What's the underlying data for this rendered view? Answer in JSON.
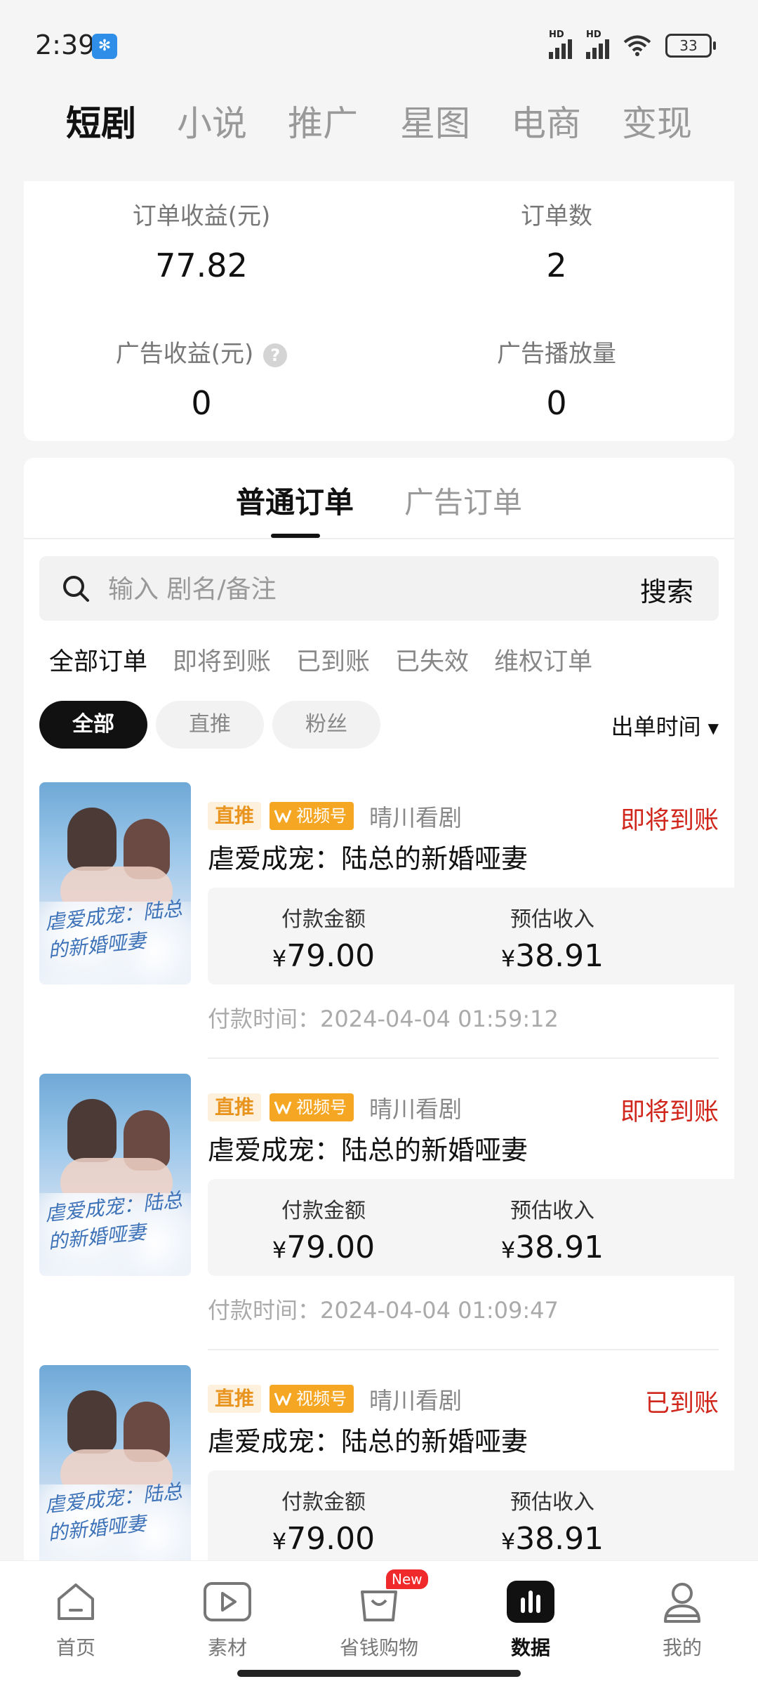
{
  "status_bar": {
    "time": "2:39",
    "battery": "33",
    "signal_label": "HD"
  },
  "top_tabs": [
    {
      "label": "短剧",
      "active": true
    },
    {
      "label": "小说",
      "active": false
    },
    {
      "label": "推广",
      "active": false
    },
    {
      "label": "星图",
      "active": false
    },
    {
      "label": "电商",
      "active": false
    },
    {
      "label": "变现",
      "active": false
    }
  ],
  "stats": {
    "order_income_label": "订单收益(元)",
    "order_income_value": "77.82",
    "order_count_label": "订单数",
    "order_count_value": "2",
    "ad_income_label": "广告收益(元)",
    "ad_income_value": "0",
    "ad_plays_label": "广告播放量",
    "ad_plays_value": "0"
  },
  "order_tabs": {
    "normal": "普通订单",
    "ad": "广告订单"
  },
  "search": {
    "placeholder": "输入 剧名/备注",
    "button": "搜索"
  },
  "filters": [
    "全部订单",
    "即将到账",
    "已到账",
    "已失效",
    "维权订单"
  ],
  "chips": [
    "全部",
    "直推",
    "粉丝"
  ],
  "sort_label": "出单时间",
  "orders": [
    {
      "tag": "直推",
      "channel_tag": "视频号",
      "channel_name": "晴川看剧",
      "status": "即将到账",
      "title": "虐爱成宠：陆总的新婚哑妻",
      "pay_label": "付款金额",
      "pay_value": "79.00",
      "income_label": "预估收入",
      "income_value": "38.91",
      "pay_time": "付款时间：2024-04-04 01:59:12",
      "poster_title": "虐爱成宠：陆总的新婚哑妻"
    },
    {
      "tag": "直推",
      "channel_tag": "视频号",
      "channel_name": "晴川看剧",
      "status": "即将到账",
      "title": "虐爱成宠：陆总的新婚哑妻",
      "pay_label": "付款金额",
      "pay_value": "79.00",
      "income_label": "预估收入",
      "income_value": "38.91",
      "pay_time": "付款时间：2024-04-04 01:09:47",
      "poster_title": "虐爱成宠：陆总的新婚哑妻"
    },
    {
      "tag": "直推",
      "channel_tag": "视频号",
      "channel_name": "晴川看剧",
      "status": "已到账",
      "title": "虐爱成宠：陆总的新婚哑妻",
      "pay_label": "付款金额",
      "pay_value": "79.00",
      "income_label": "预估收入",
      "income_value": "38.91",
      "pay_time": "",
      "poster_title": "虐爱成宠：陆总的新婚哑妻"
    }
  ],
  "currency_symbol": "¥",
  "bottom_nav": [
    {
      "label": "首页",
      "icon": "home-icon"
    },
    {
      "label": "素材",
      "icon": "play-icon"
    },
    {
      "label": "省钱购物",
      "icon": "shopping-bag-icon",
      "badge": "New"
    },
    {
      "label": "数据",
      "icon": "bar-chart-icon",
      "active": true
    },
    {
      "label": "我的",
      "icon": "person-icon"
    }
  ],
  "colors": {
    "accent_red": "#d0261c",
    "tag_orange": "#f5a623",
    "active_dark": "#111111"
  }
}
